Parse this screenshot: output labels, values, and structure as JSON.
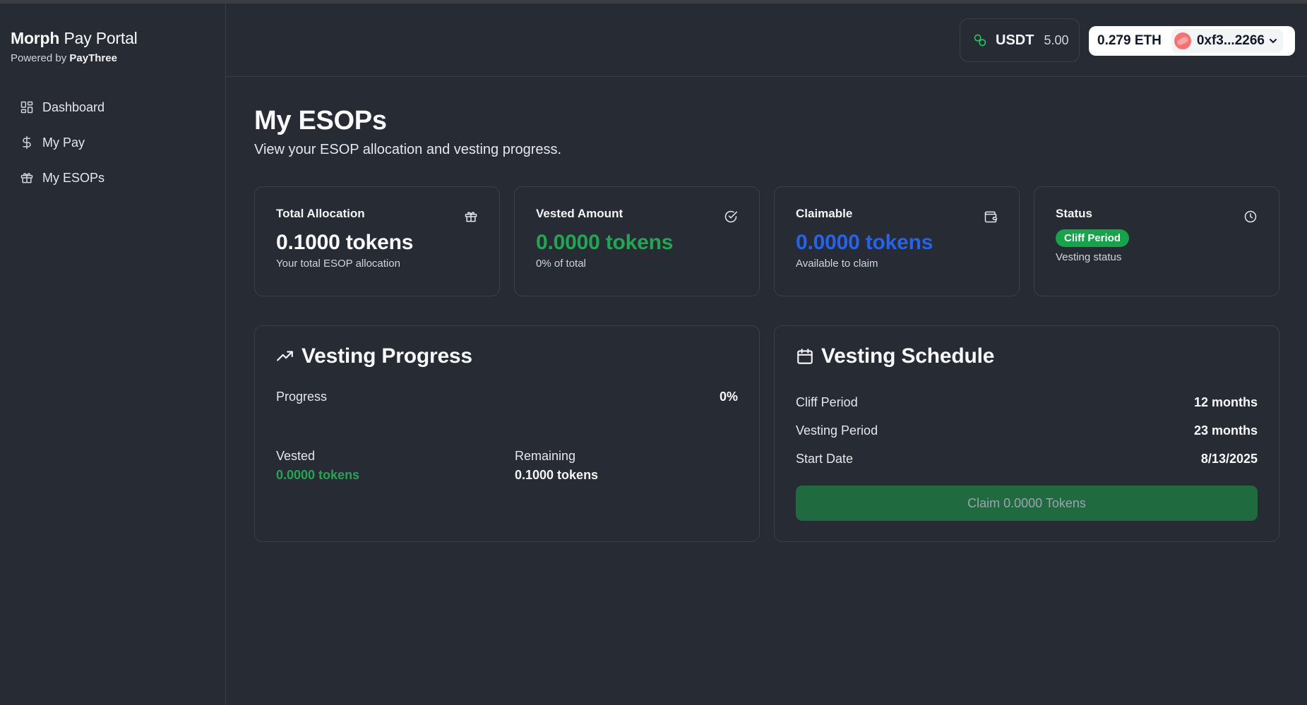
{
  "brand": {
    "title_bold": "Morph",
    "title_rest": "Pay Portal",
    "powered_prefix": "Powered by",
    "powered_name": "PayThree"
  },
  "sidebar": {
    "items": [
      {
        "label": "Dashboard",
        "icon": "dashboard-grid-icon"
      },
      {
        "label": "My Pay",
        "icon": "dollar-icon"
      },
      {
        "label": "My ESOPs",
        "icon": "gift-icon"
      }
    ]
  },
  "header": {
    "token_symbol": "USDT",
    "token_amount": "5.00",
    "eth_balance": "0.279 ETH",
    "wallet_address": "0xf3...2266"
  },
  "page": {
    "title": "My ESOPs",
    "subtitle": "View your ESOP allocation and vesting progress."
  },
  "stats": {
    "total": {
      "label": "Total Allocation",
      "value": "0.1000 tokens",
      "note": "Your total ESOP allocation",
      "icon": "gift-icon"
    },
    "vested": {
      "label": "Vested Amount",
      "value": "0.0000 tokens",
      "note": "0% of total",
      "icon": "check-circle-icon"
    },
    "claimable": {
      "label": "Claimable",
      "value": "0.0000 tokens",
      "note": "Available to claim",
      "icon": "wallet-icon"
    },
    "status": {
      "label": "Status",
      "badge": "Cliff Period",
      "note": "Vesting status",
      "icon": "clock-icon"
    }
  },
  "progress": {
    "title": "Vesting Progress",
    "progress_label": "Progress",
    "progress_value": "0%",
    "vested_label": "Vested",
    "vested_value": "0.0000 tokens",
    "remaining_label": "Remaining",
    "remaining_value": "0.1000 tokens"
  },
  "schedule": {
    "title": "Vesting Schedule",
    "rows": [
      {
        "label": "Cliff Period",
        "value": "12 months"
      },
      {
        "label": "Vesting Period",
        "value": "23 months"
      },
      {
        "label": "Start Date",
        "value": "8/13/2025"
      }
    ],
    "claim_label": "Claim 0.0000 Tokens"
  },
  "colors": {
    "background": "#272b34",
    "border": "#3a3f4a",
    "green": "#22a652",
    "blue": "#2563eb",
    "badge_green": "#16a34a",
    "claim_button": "#1f6a3e"
  }
}
